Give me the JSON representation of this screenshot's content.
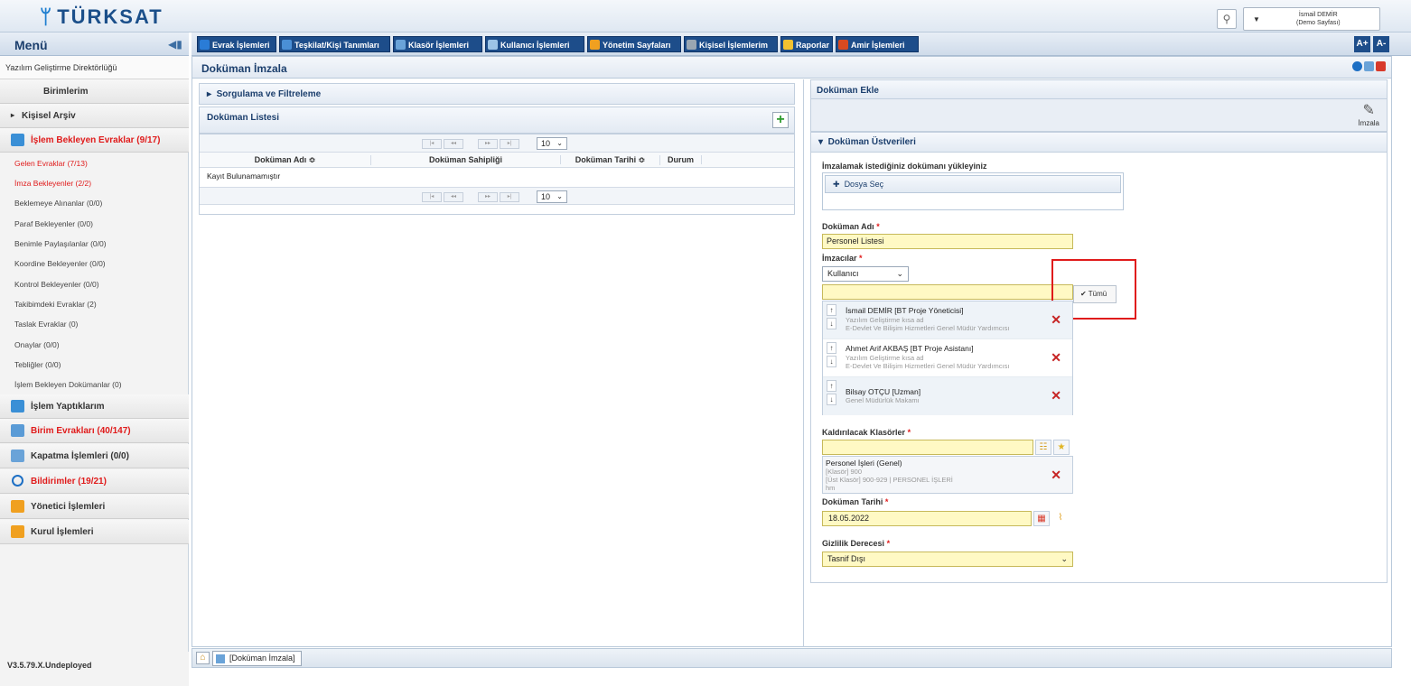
{
  "app": {
    "logo": "TÜRKSAT",
    "user": "İsmail DEMİR",
    "user_sub": "(Demo Sayfası)"
  },
  "menu": {
    "title": "Menü"
  },
  "nav": [
    {
      "label": "Evrak İşlemleri",
      "color": "#2a7cd6"
    },
    {
      "label": "Teşkilat/Kişi Tanımları",
      "color": "#4a8fd6"
    },
    {
      "label": "Klasör İşlemleri",
      "color": "#6aa3d8"
    },
    {
      "label": "Kullanıcı İşlemleri",
      "color": "#9cc3e6"
    },
    {
      "label": "Yönetim Sayfaları",
      "color": "#f0a020"
    },
    {
      "label": "Kişisel İşlemlerim",
      "color": "#9aa6b2"
    },
    {
      "label": "Raporlar",
      "color": "#f2c230"
    },
    {
      "label": "Amir İşlemleri",
      "color": "#d84a20"
    }
  ],
  "font_buttons": [
    "A+",
    "A-"
  ],
  "sidebar": {
    "org": "Yazılım Geliştirme Direktörlüğü",
    "birimlerim": "Birimlerim",
    "kisisel_arsiv": "Kişisel Arşiv",
    "islem_bekleyen": "İşlem Bekleyen Evraklar (9/17)",
    "sub": [
      {
        "label": "Gelen Evraklar (7/13)",
        "red": true
      },
      {
        "label": "İmza Bekleyenler (2/2)",
        "red": true
      },
      {
        "label": "Beklemeye Alınanlar (0/0)",
        "red": false
      },
      {
        "label": "Paraf Bekleyenler (0/0)",
        "red": false
      },
      {
        "label": "Benimle Paylaşılanlar (0/0)",
        "red": false
      },
      {
        "label": "Koordine Bekleyenler (0/0)",
        "red": false
      },
      {
        "label": "Kontrol Bekleyenler (0/0)",
        "red": false
      },
      {
        "label": "Takibimdeki Evraklar (2)",
        "red": false
      },
      {
        "label": "Taslak Evraklar (0)",
        "red": false
      },
      {
        "label": "Onaylar (0/0)",
        "red": false
      },
      {
        "label": "Tebliğler (0/0)",
        "red": false
      },
      {
        "label": "İşlem Bekleyen Dokümanlar (0)",
        "red": false
      }
    ],
    "islem_yaptiklarim": "İşlem Yaptıklarım",
    "birim_evraklari": "Birim Evrakları (40/147)",
    "kapatma": "Kapatma İşlemleri (0/0)",
    "bildirimler": "Bildirimler (19/21)",
    "yonetici": "Yönetici İşlemleri",
    "kurul": "Kurul İşlemleri",
    "version": "V3.5.79.X.Undeployed"
  },
  "page": {
    "title": "Doküman İmzala",
    "tab": "[Doküman İmzala]"
  },
  "left": {
    "filter": "Sorgulama ve Filtreleme",
    "list_title": "Doküman Listesi",
    "page_size": "10",
    "columns": [
      "Doküman Adı ≎",
      "Doküman Sahipliği",
      "Doküman Tarihi ≎",
      "Durum"
    ],
    "empty": "Kayıt Bulunamamıştır"
  },
  "right": {
    "title": "Doküman Ekle",
    "sign_label": "İmzala",
    "meta_title": "Doküman Üstverileri",
    "upload_label": "İmzalamak istediğiniz dokümanı yükleyiniz",
    "upload_btn": "Dosya Seç",
    "doc_name_label": "Doküman Adı",
    "doc_name": "Personel Listesi",
    "signers_label": "İmzacılar",
    "signer_type": "Kullanıcı",
    "tumu": "Tümü",
    "signers": [
      {
        "name": "İsmail DEMİR [BT Proje Yöneticisi]",
        "l1": "Yazılım Geliştirme kısa ad",
        "l2": "E-Devlet Ve Bilişim Hizmetleri Genel Müdür Yardımcısı"
      },
      {
        "name": "Ahmet Arif AKBAŞ [BT Proje Asistanı]",
        "l1": "Yazılım Geliştirme kısa ad",
        "l2": "E-Devlet Ve Bilişim Hizmetleri Genel Müdür Yardımcısı"
      },
      {
        "name": "Bilsay OTÇU [Uzman]",
        "l1": "Genel Müdürlük Makamı",
        "l2": ""
      }
    ],
    "folders_label": "Kaldırılacak Klasörler",
    "folder": {
      "name": "Personel İşleri (Genel)",
      "l1": "[Klasör] 900",
      "l2": "[Üst Klasör] 900-929 | PERSONEL İŞLERİ",
      "l3": "hm"
    },
    "date_label": "Doküman Tarihi",
    "date": "18.05.2022",
    "privacy_label": "Gizlilik Derecesi",
    "privacy": "Tasnif Dışı"
  },
  "colors": {
    "accent": "#1d4d8a",
    "red": "#e01b1b",
    "input_yellow": "#fff9c4"
  }
}
